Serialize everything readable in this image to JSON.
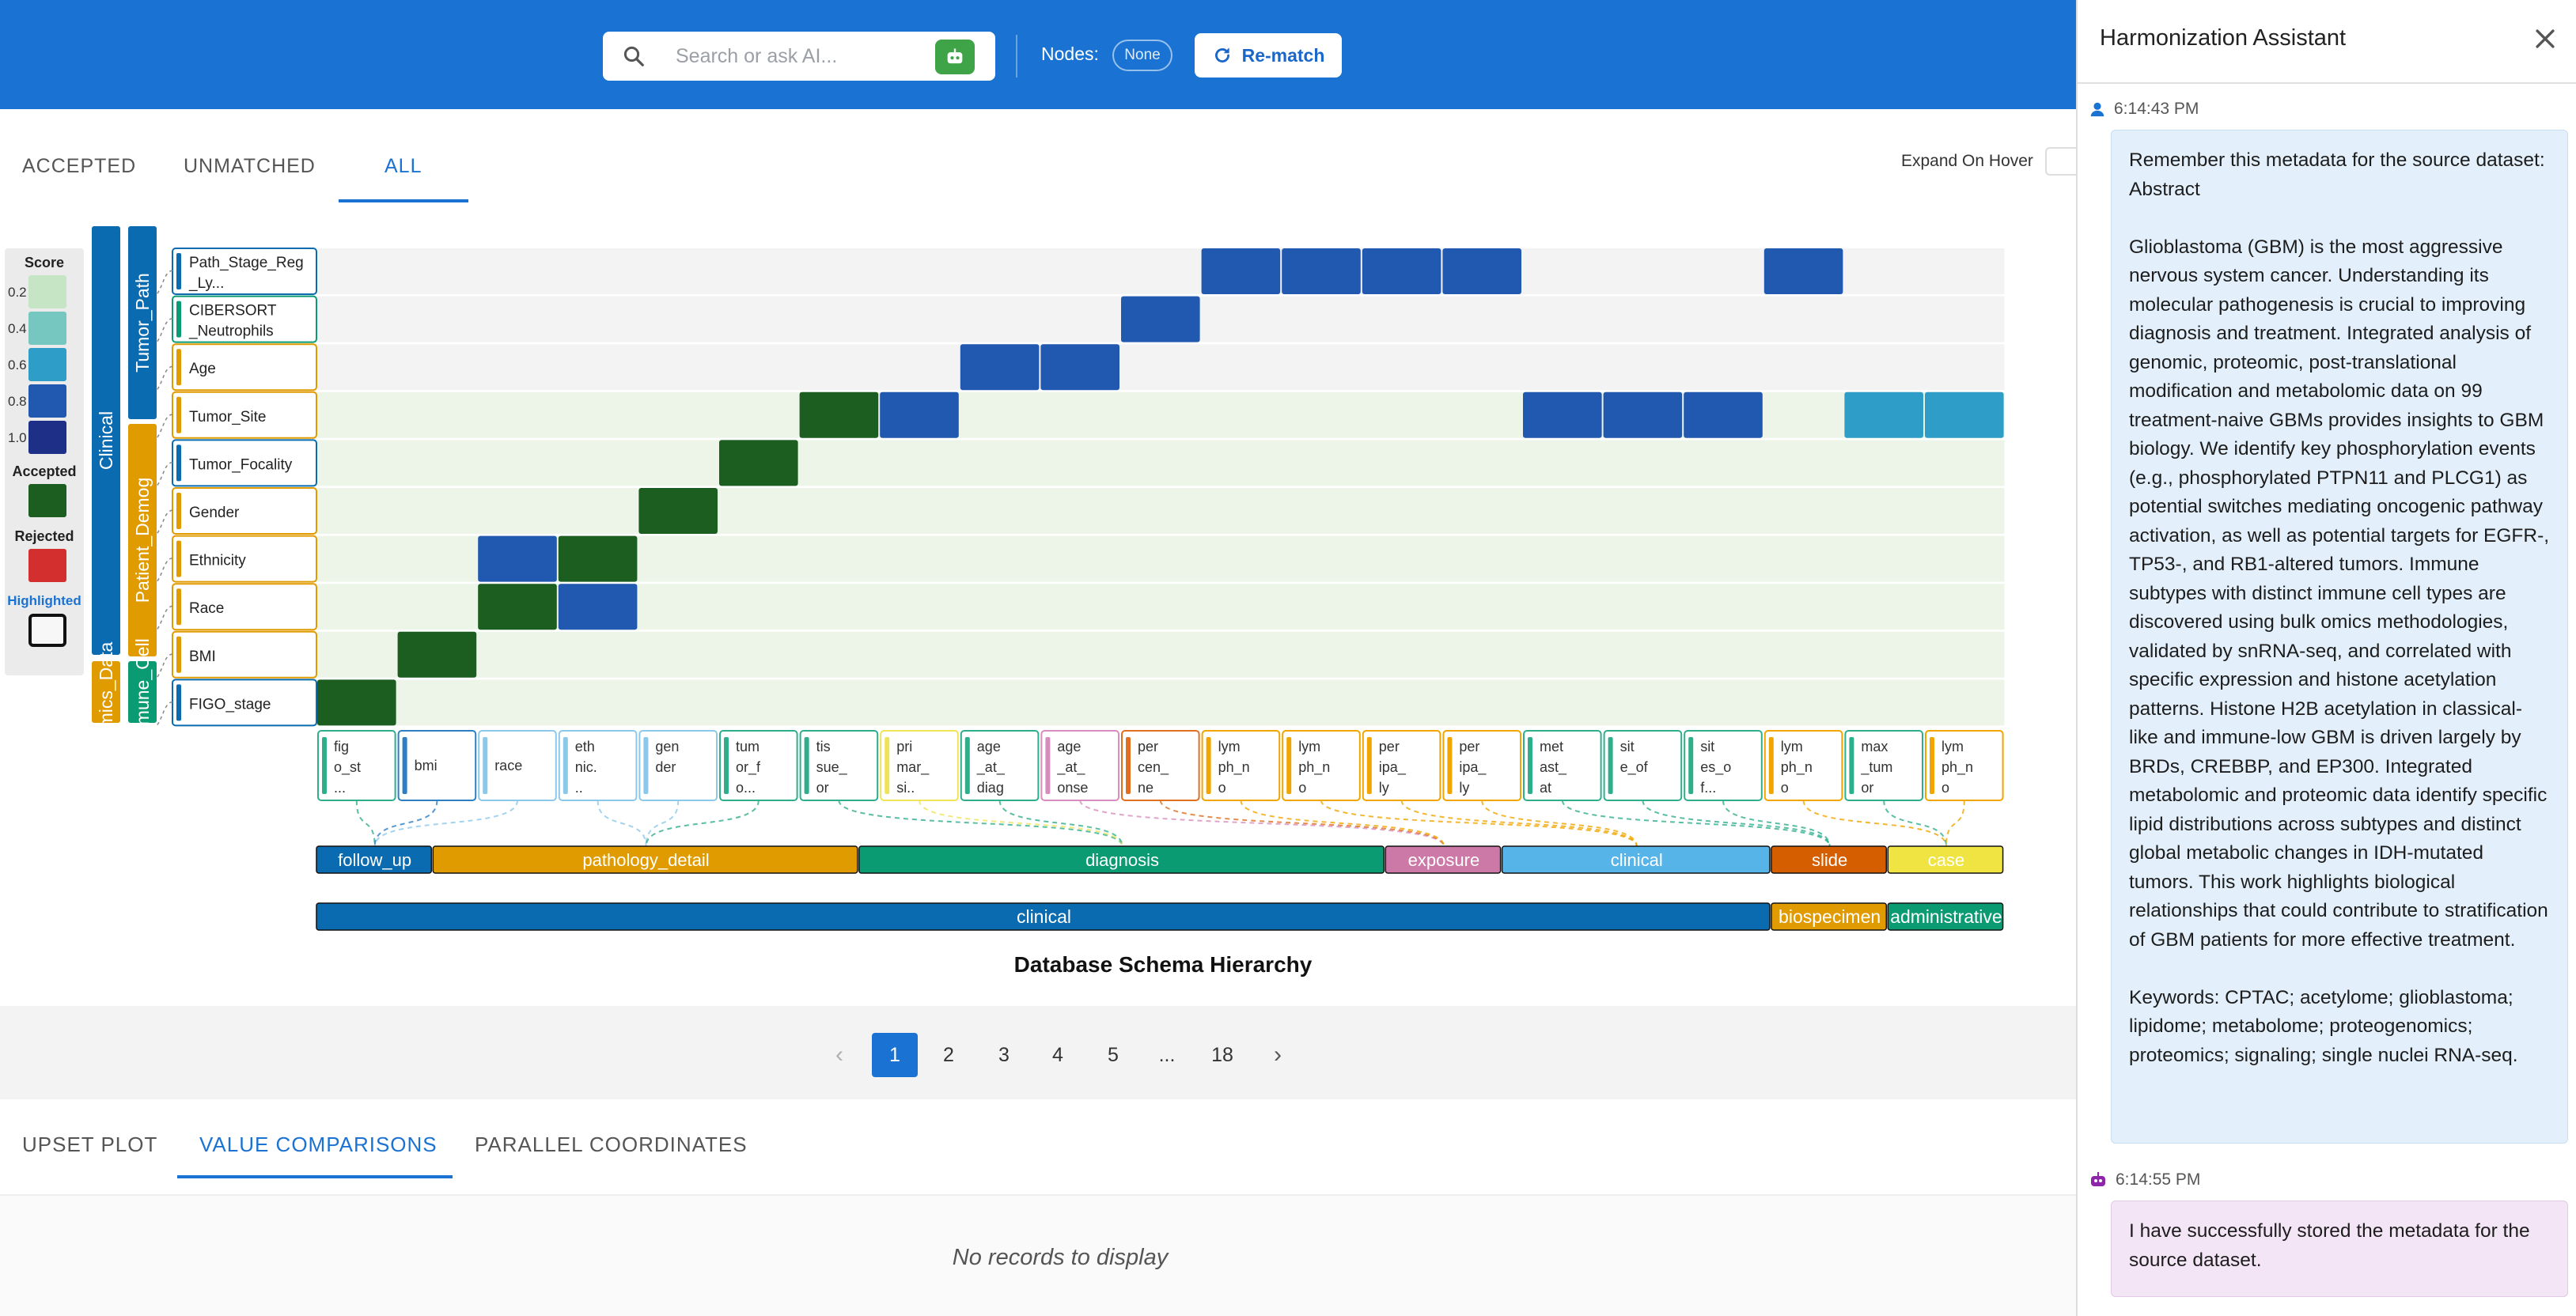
{
  "topbar": {
    "search_placeholder": "Search or ask AI...",
    "nodes_label": "Nodes:",
    "nodes_value": "None",
    "rematch_label": "Re-match"
  },
  "tabs": [
    {
      "label": "ACCEPTED"
    },
    {
      "label": "UNMATCHED"
    },
    {
      "label": "ALL"
    }
  ],
  "expand_on_hover_label": "Expand On Hover",
  "legend": {
    "score_title": "Score",
    "ticks": [
      "0.2",
      "0.4",
      "0.6",
      "0.8",
      "1.0"
    ],
    "score_colors": [
      "#c6e5c5",
      "#76c7bf",
      "#2e9ec8",
      "#2259b0",
      "#1d2f86"
    ],
    "accepted_label": "Accepted",
    "accepted_color": "#1b5e20",
    "rejected_label": "Rejected",
    "rejected_color": "#d32f2f",
    "highlighted_label": "Highlighted",
    "highlighted_color": "#1a73d2"
  },
  "heatmap": {
    "source_groups_outer": [
      {
        "label": "Clinical",
        "color": "#0b6bb0"
      },
      {
        "label": "Omics_Data",
        "color": "#e09b00"
      }
    ],
    "source_groups_inner": [
      {
        "label": "Tumor_Path",
        "color": "#0b6bb0"
      },
      {
        "label": "Patient_Demog",
        "color": "#e09b00"
      },
      {
        "label": "Immune_Cell",
        "color": "#0b9b73"
      }
    ],
    "source_rows": [
      {
        "label": "Path_Stage_Reg_Ly...",
        "color": "#0b6bb0"
      },
      {
        "label": "CIBERSORT_Neutrophils",
        "color": "#0b9b73"
      },
      {
        "label": "Age",
        "color": "#e09b00"
      },
      {
        "label": "Tumor_Site",
        "color": "#e09b00"
      },
      {
        "label": "Tumor_Focality",
        "color": "#0b6bb0"
      },
      {
        "label": "Gender",
        "color": "#e09b00"
      },
      {
        "label": "Ethnicity",
        "color": "#e09b00"
      },
      {
        "label": "Race",
        "color": "#e09b00"
      },
      {
        "label": "BMI",
        "color": "#e09b00"
      },
      {
        "label": "FIGO_stage",
        "color": "#0b6bb0"
      }
    ],
    "target_columns": [
      {
        "label": "figo_st...",
        "color": "#2fae8c"
      },
      {
        "label": "bmi",
        "color": "#2c7fc4"
      },
      {
        "label": "race",
        "color": "#8cc8ea"
      },
      {
        "label": "ethnic...",
        "color": "#8cc8ea"
      },
      {
        "label": "gender",
        "color": "#8cc8ea"
      },
      {
        "label": "tumor_fo...",
        "color": "#2fae8c"
      },
      {
        "label": "tissue_or",
        "color": "#2fae8c"
      },
      {
        "label": "primar_si...",
        "color": "#efe35a"
      },
      {
        "label": "age_at_diagnosis",
        "color": "#2fae8c"
      },
      {
        "label": "age_at_onset",
        "color": "#d88dbf"
      },
      {
        "label": "percen_ne",
        "color": "#e07020"
      },
      {
        "label": "lymph_no",
        "color": "#f0a500"
      },
      {
        "label": "lymph_no",
        "color": "#f0a500"
      },
      {
        "label": "peripa_ly",
        "color": "#f0a500"
      },
      {
        "label": "peripa_ly",
        "color": "#f0a500"
      },
      {
        "label": "metast_at",
        "color": "#2fae8c"
      },
      {
        "label": "site_of",
        "color": "#2fae8c"
      },
      {
        "label": "sites_of...",
        "color": "#2fae8c"
      },
      {
        "label": "lymph_no",
        "color": "#f0a500"
      },
      {
        "label": "max_tumor",
        "color": "#2fae8c"
      },
      {
        "label": "lymph_no",
        "color": "#f0a500"
      }
    ],
    "cells": [
      {
        "row": 0,
        "col": 11,
        "kind": "score",
        "score": 0.85
      },
      {
        "row": 0,
        "col": 12,
        "kind": "score",
        "score": 0.8
      },
      {
        "row": 0,
        "col": 13,
        "kind": "score",
        "score": 0.8
      },
      {
        "row": 0,
        "col": 14,
        "kind": "score",
        "score": 0.8
      },
      {
        "row": 0,
        "col": 18,
        "kind": "score",
        "score": 0.8
      },
      {
        "row": 1,
        "col": 10,
        "kind": "score",
        "score": 0.85
      },
      {
        "row": 2,
        "col": 8,
        "kind": "score",
        "score": 0.85
      },
      {
        "row": 2,
        "col": 9,
        "kind": "score",
        "score": 0.8
      },
      {
        "row": 3,
        "col": 6,
        "kind": "accepted"
      },
      {
        "row": 3,
        "col": 7,
        "kind": "score",
        "score": 0.85
      },
      {
        "row": 3,
        "col": 15,
        "kind": "score",
        "score": 0.8
      },
      {
        "row": 3,
        "col": 16,
        "kind": "score",
        "score": 0.8
      },
      {
        "row": 3,
        "col": 17,
        "kind": "score",
        "score": 0.8
      },
      {
        "row": 3,
        "col": 19,
        "kind": "score",
        "score": 0.65
      },
      {
        "row": 3,
        "col": 20,
        "kind": "score",
        "score": 0.65
      },
      {
        "row": 4,
        "col": 5,
        "kind": "accepted"
      },
      {
        "row": 5,
        "col": 4,
        "kind": "accepted"
      },
      {
        "row": 6,
        "col": 2,
        "kind": "score",
        "score": 0.8
      },
      {
        "row": 6,
        "col": 3,
        "kind": "accepted"
      },
      {
        "row": 7,
        "col": 2,
        "kind": "accepted"
      },
      {
        "row": 7,
        "col": 3,
        "kind": "score",
        "score": 0.8
      },
      {
        "row": 8,
        "col": 1,
        "kind": "accepted"
      },
      {
        "row": 9,
        "col": 0,
        "kind": "accepted"
      }
    ],
    "categories": [
      {
        "label": "follow_up",
        "color": "#0b6bb0",
        "span": 1.45
      },
      {
        "label": "pathology_detail",
        "color": "#e09b00",
        "span": 5.3
      },
      {
        "label": "diagnosis",
        "color": "#0b9b73",
        "span": 6.55
      },
      {
        "label": "exposure",
        "color": "#cc79a7",
        "span": 1.45
      },
      {
        "label": "clinical",
        "color": "#56b4e9",
        "span": 3.35
      },
      {
        "label": "slide",
        "color": "#d55e00",
        "span": 1.45
      },
      {
        "label": "case",
        "color": "#f0e442",
        "span": 1.45
      }
    ],
    "nodes": [
      {
        "label": "clinical",
        "color": "#0b6bb0",
        "span": 18.1
      },
      {
        "label": "biospecimen",
        "color": "#e09b00",
        "span": 1.45
      },
      {
        "label": "administrative",
        "color": "#0b9b73",
        "span": 1.45
      }
    ]
  },
  "schema_title": "Database Schema Hierarchy",
  "pagination": {
    "pages": [
      "1",
      "2",
      "3",
      "4",
      "5",
      "...",
      "18"
    ],
    "active": "1"
  },
  "bottom_tabs": [
    {
      "label": "UPSET PLOT"
    },
    {
      "label": "VALUE COMPARISONS"
    },
    {
      "label": "PARALLEL COORDINATES"
    }
  ],
  "no_records": "No records to display",
  "assistant": {
    "title": "Harmonization Assistant",
    "messages": [
      {
        "role": "user",
        "time": "6:14:43 PM",
        "text": "Remember this metadata for the source dataset: Abstract\n\nGlioblastoma (GBM) is the most aggressive nervous system cancer. Understanding its molecular pathogenesis is crucial to improving diagnosis and treatment. Integrated analysis of genomic, proteomic, post-translational modification and metabolomic data on 99 treatment-naive GBMs provides insights to GBM biology. We identify key phosphorylation events (e.g., phosphorylated PTPN11 and PLCG1) as potential switches mediating oncogenic pathway activation, as well as potential targets for EGFR-, TP53-, and RB1-altered tumors. Immune subtypes with distinct immune cell types are discovered using bulk omics methodologies, validated by snRNA-seq, and correlated with specific expression and histone acetylation patterns. Histone H2B acetylation in classical-like and immune-low GBM is driven largely by BRDs, CREBBP, and EP300. Integrated metabolomic and proteomic data identify specific lipid distributions across subtypes and distinct global metabolic changes in IDH-mutated tumors. This work highlights biological relationships that could contribute to stratification of GBM patients for more effective treatment.\n\nKeywords: CPTAC; acetylome; glioblastoma; lipidome; metabolome; proteogenomics; proteomics; signaling; single nuclei RNA-seq."
      },
      {
        "role": "bot",
        "time": "6:14:55 PM",
        "text": "I have successfully stored the metadata for the source dataset."
      }
    ]
  }
}
